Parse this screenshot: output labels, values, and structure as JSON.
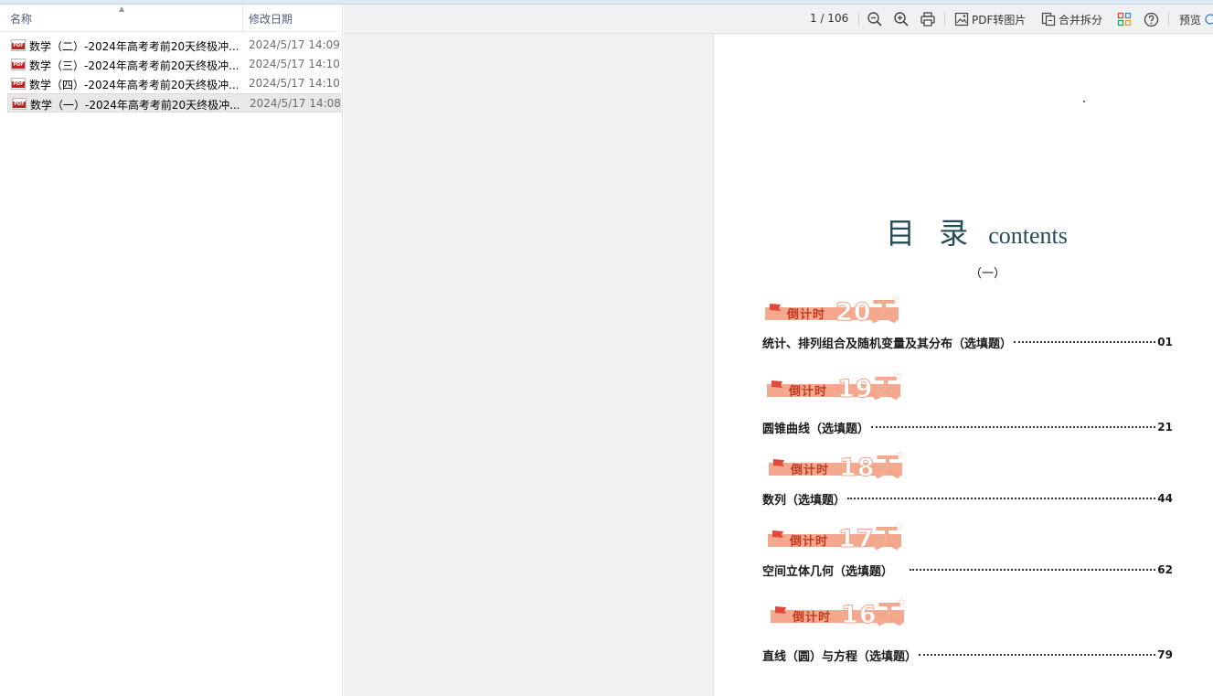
{
  "file_list": {
    "columns": {
      "name": "名称",
      "date": "修改日期"
    },
    "files": [
      {
        "name": "数学（二）-2024年高考考前20天终极冲...",
        "date": "2024/5/17 14:09",
        "icon": "pdf-icon",
        "icon_label": "PDF"
      },
      {
        "name": "数学（三）-2024年高考考前20天终极冲...",
        "date": "2024/5/17 14:10",
        "icon": "pdf-icon",
        "icon_label": "PDF"
      },
      {
        "name": "数学（四）-2024年高考考前20天终极冲...",
        "date": "2024/5/17 14:10",
        "icon": "pdf-icon",
        "icon_label": "PDF"
      },
      {
        "name": "数学（一）-2024年高考考前20天终极冲...",
        "date": "2024/5/17 14:08",
        "icon": "pdf-icon",
        "icon_label": "PDF",
        "selected": true
      }
    ]
  },
  "toolbar": {
    "page_indicator": "1 / 106",
    "pdf_to_image": "PDF转图片",
    "merge_split": "合并拆分",
    "preview": "预览"
  },
  "document": {
    "title_zh": "目 录",
    "title_en": "contents",
    "subtitle": "（一）",
    "banner_label": "倒计时",
    "accent_color": "#f4a98e",
    "sections": [
      {
        "countdown": "20天",
        "title": "统计、排列组合及随机变量及其分布（选填题）",
        "page": "01"
      },
      {
        "countdown": "19天",
        "title": "圆锥曲线（选填题）",
        "page": "21"
      },
      {
        "countdown": "18天",
        "title": "数列（选填题）",
        "page": "44"
      },
      {
        "countdown": "17天",
        "title": "空间立体几何（选填题）",
        "page": "62"
      },
      {
        "countdown": "16天",
        "title": "直线（圆）与方程（选填题）",
        "page": "79"
      }
    ]
  }
}
